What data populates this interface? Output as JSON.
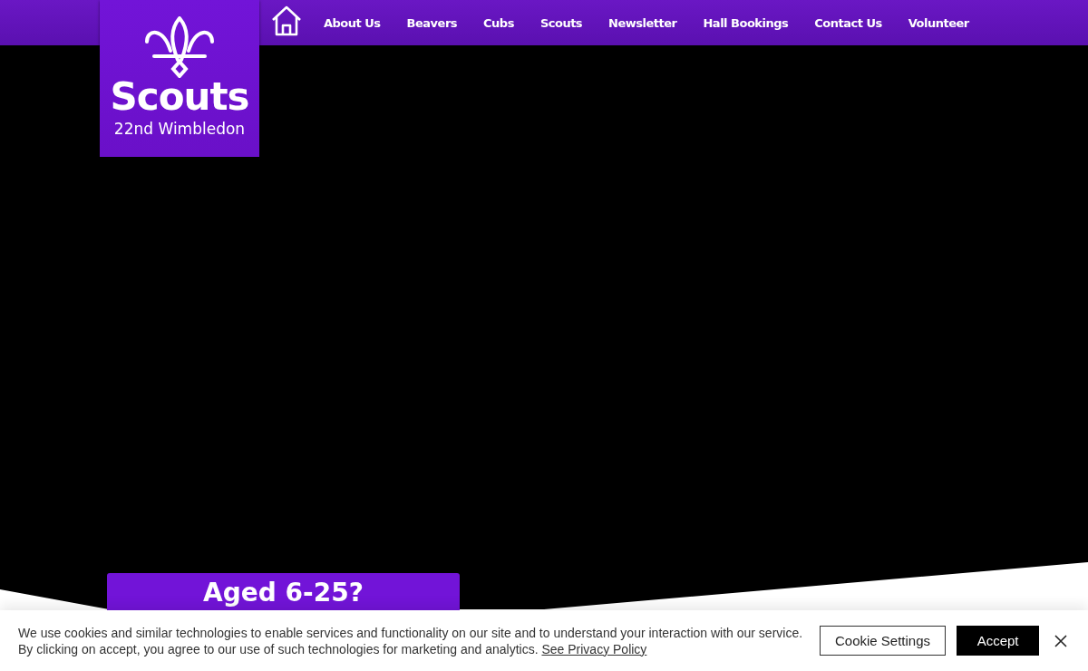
{
  "logo": {
    "title": "Scouts",
    "subtitle": "22nd Wimbledon"
  },
  "nav": {
    "items": [
      {
        "label": "About Us"
      },
      {
        "label": "Beavers"
      },
      {
        "label": "Cubs"
      },
      {
        "label": "Scouts"
      },
      {
        "label": "Newsletter"
      },
      {
        "label": "Hall Bookings"
      },
      {
        "label": "Contact Us"
      },
      {
        "label": "Volunteer"
      }
    ]
  },
  "hero": {
    "card_heading": "Aged 6-25?"
  },
  "cookie_banner": {
    "lines": [
      "We use cookies and similar technologies to enable services and functionality on our site and to understand your interaction with our service.",
      "By clicking on accept, you agree to our use of such technologies for marketing and analytics."
    ],
    "link": "See Privacy Policy",
    "buttons": [
      {
        "label": "Cookie Settings",
        "kind": "outline"
      },
      {
        "label": "Accept",
        "kind": "solid"
      }
    ]
  }
}
